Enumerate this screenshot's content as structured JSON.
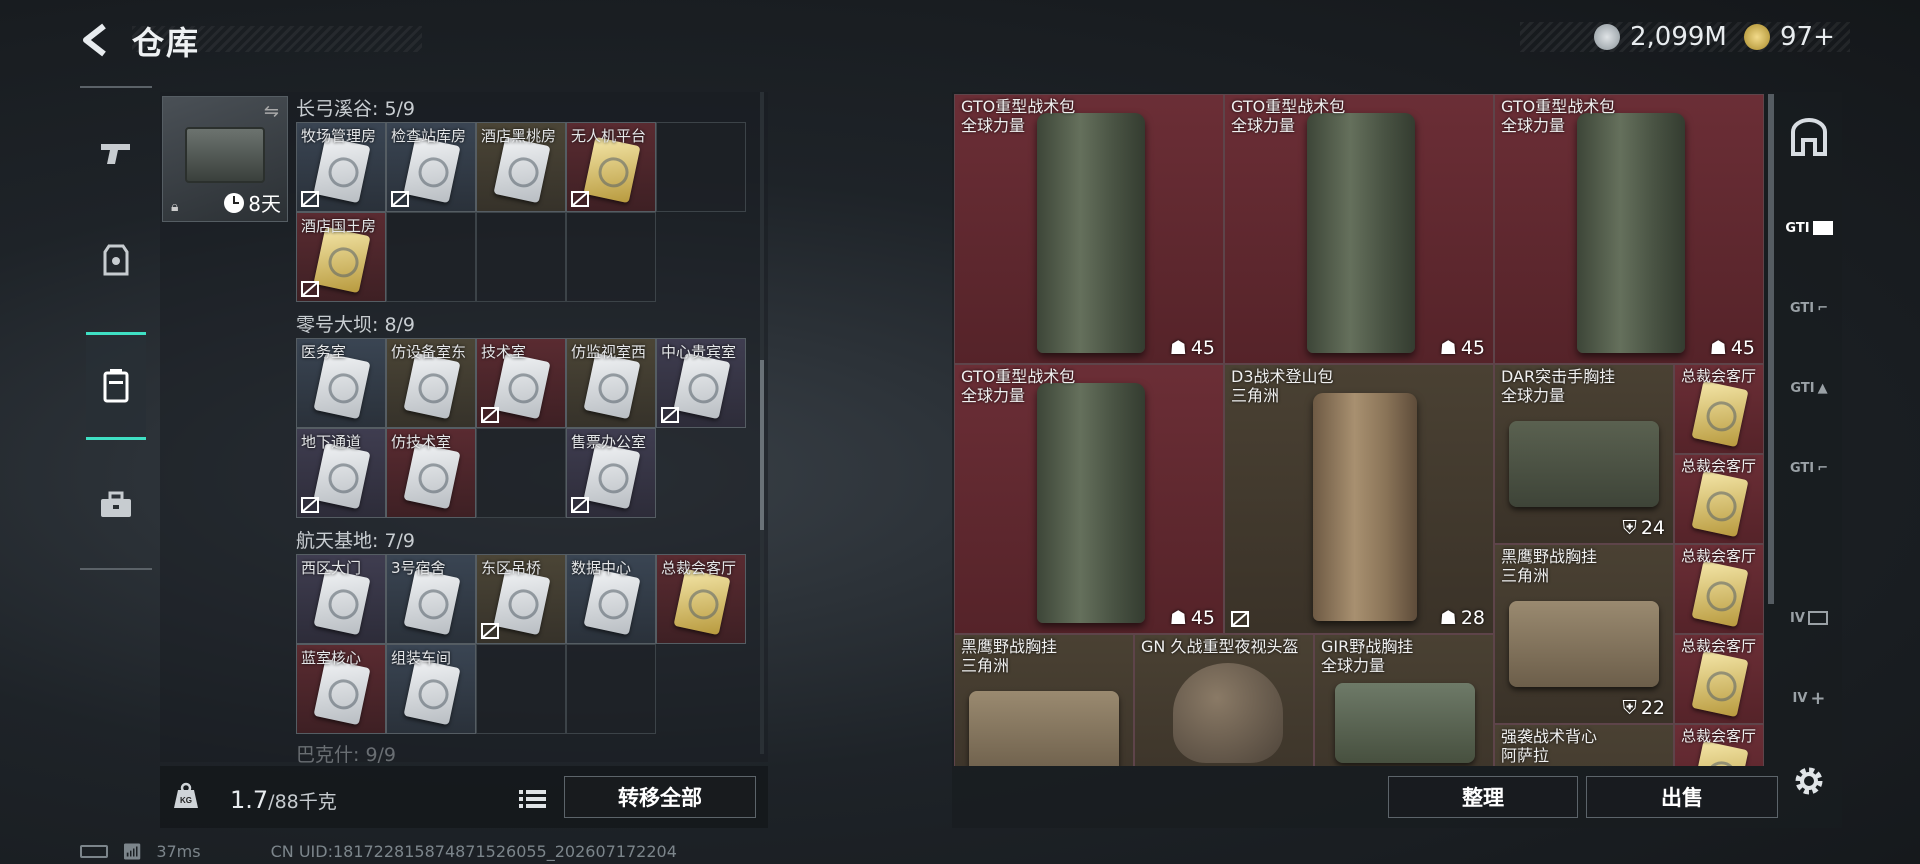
{
  "header": {
    "title": "仓库",
    "currency1": "2,099M",
    "currency2": "97+"
  },
  "left_rail": [
    "gun-icon",
    "armor-icon",
    "case-icon",
    "toolbox-icon"
  ],
  "case": {
    "days": "8天"
  },
  "regions": [
    {
      "title": "长弓溪谷: 5/9",
      "cards": [
        {
          "label": "牧场管理房",
          "color": "blue",
          "gold": false,
          "noflag": true
        },
        {
          "label": "检查站库房",
          "color": "blue",
          "gold": false,
          "noflag": true
        },
        {
          "label": "酒店黑桃房",
          "color": "olive",
          "gold": false,
          "noflag": false
        },
        {
          "label": "无人机平台",
          "color": "red",
          "gold": true,
          "noflag": true
        },
        {
          "label": "",
          "color": "empty"
        },
        {
          "label": "酒店国王房",
          "color": "red",
          "gold": true,
          "noflag": true
        },
        {
          "label": "",
          "color": "empty"
        },
        {
          "label": "",
          "color": "empty"
        },
        {
          "label": "",
          "color": "empty"
        }
      ]
    },
    {
      "title": "零号大坝: 8/9",
      "cards": [
        {
          "label": "医务室",
          "color": "blue",
          "gold": false,
          "noflag": false
        },
        {
          "label": "仿设备室东",
          "color": "olive",
          "gold": false,
          "noflag": false
        },
        {
          "label": "技术室",
          "color": "red",
          "gold": false,
          "noflag": true
        },
        {
          "label": "仿监视室西",
          "color": "olive",
          "gold": false,
          "noflag": false
        },
        {
          "label": "中心贵宾室",
          "color": "purple",
          "gold": false,
          "noflag": true
        },
        {
          "label": "地下通道",
          "color": "purple",
          "gold": false,
          "noflag": true
        },
        {
          "label": "仿技术室",
          "color": "red",
          "gold": false,
          "noflag": false
        },
        {
          "label": "",
          "color": "empty"
        },
        {
          "label": "售票办公室",
          "color": "purple",
          "gold": false,
          "noflag": true
        }
      ]
    },
    {
      "title": "航天基地: 7/9",
      "cards": [
        {
          "label": "西区大门",
          "color": "purple",
          "gold": false,
          "noflag": false
        },
        {
          "label": "3号宿舍",
          "color": "blue",
          "gold": false,
          "noflag": false
        },
        {
          "label": "东区吊桥",
          "color": "olive",
          "gold": false,
          "noflag": true
        },
        {
          "label": "数据中心",
          "color": "blue",
          "gold": false,
          "noflag": false
        },
        {
          "label": "总裁会客厅",
          "color": "red",
          "gold": true,
          "noflag": false
        },
        {
          "label": "蓝室核心",
          "color": "red",
          "gold": false,
          "noflag": false
        },
        {
          "label": "组装车间",
          "color": "blue",
          "gold": false,
          "noflag": false
        },
        {
          "label": "",
          "color": "empty"
        },
        {
          "label": "",
          "color": "empty"
        }
      ]
    }
  ],
  "next_region_title": "巴克什: 9/9",
  "weight": {
    "current": "1.7",
    "max": "/88千克"
  },
  "buttons": {
    "transfer_all": "转移全部",
    "organize": "整理",
    "sell": "出售"
  },
  "status": {
    "ping": "37ms",
    "uid": "CN UID:18172281587487152​6055_202607172204"
  },
  "right_items": [
    {
      "name": "GTO重型战术包",
      "sub": "全球力量",
      "qty": "45"
    },
    {
      "name": "GTO重型战术包",
      "sub": "全球力量",
      "qty": "45"
    },
    {
      "name": "GTO重型战术包",
      "sub": "全球力量",
      "qty": "45"
    },
    {
      "name": "GTO重型战术包",
      "sub": "全球力量",
      "qty": "45"
    },
    {
      "name": "D3战术登山包",
      "sub": "三角洲",
      "qty": "28"
    },
    {
      "name": "DAR突击手胸挂",
      "sub": "全球力量",
      "qty": "24"
    },
    {
      "name": "黑鹰野战胸挂",
      "sub": "三角洲",
      "qty": "22"
    },
    {
      "name": "黑鹰野战胸挂",
      "sub": "三角洲",
      "qty": ""
    },
    {
      "name": "GN 久战重型夜视头盔",
      "sub": "",
      "qty": ""
    },
    {
      "name": "GIR野战胸挂",
      "sub": "全球力量",
      "qty": ""
    },
    {
      "name": "强袭战术背心",
      "sub": "阿萨拉",
      "qty": ""
    }
  ],
  "right_small": [
    "总裁会客厅",
    "总裁会客厅",
    "总裁会客厅",
    "总裁会客厅",
    "总裁会客厅"
  ],
  "right_rail": [
    "GTI",
    "GTI",
    "GTI",
    "GTI",
    "IV",
    "IV"
  ]
}
